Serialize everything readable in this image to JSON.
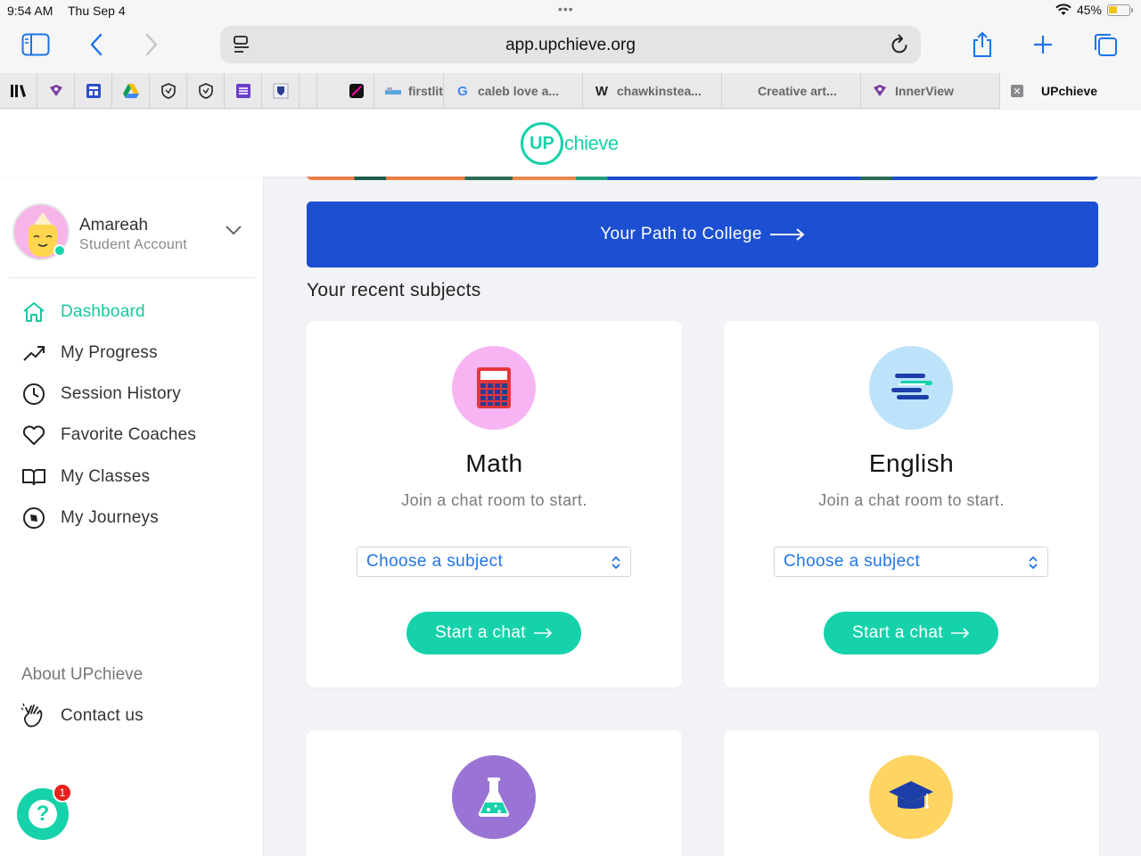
{
  "status": {
    "time": "9:54 AM",
    "date": "Thu Sep 4",
    "battery": "45%",
    "battery_level": 0.45
  },
  "browser": {
    "url": "app.upchieve.org",
    "tabs": [
      {
        "title": "firstlit",
        "icon": "book-favicon"
      },
      {
        "title": "caleb love a...",
        "icon": "google-favicon"
      },
      {
        "title": "chawkinstea...",
        "icon": "w-favicon"
      },
      {
        "title": "Creative art...",
        "icon": "blank-favicon"
      },
      {
        "title": "InnerView",
        "icon": "innerview-favicon"
      },
      {
        "title": "UPchieve",
        "icon": "close-tab-icon",
        "active": true
      }
    ]
  },
  "brand": {
    "logo_mark": "UP",
    "logo_text": "chieve",
    "accent": "#16d2aa",
    "primary": "#1c4fd1"
  },
  "user": {
    "name": "Amareah",
    "role": "Student Account"
  },
  "nav": {
    "items": [
      {
        "label": "Dashboard",
        "icon": "home-icon",
        "active": true
      },
      {
        "label": "My Progress",
        "icon": "trend-up-icon"
      },
      {
        "label": "Session History",
        "icon": "clock-icon"
      },
      {
        "label": "Favorite Coaches",
        "icon": "heart-icon"
      },
      {
        "label": "My Classes",
        "icon": "open-book-icon"
      },
      {
        "label": "My Journeys",
        "icon": "compass-icon"
      }
    ],
    "about": "About UPchieve",
    "contact": "Contact us"
  },
  "help": {
    "label": "?",
    "badge": "1"
  },
  "main": {
    "path_button": "Your Path to College",
    "recent_heading": "Your recent subjects",
    "cards": [
      {
        "title": "Math",
        "subtitle": "Join a chat room to start.",
        "select_placeholder": "Choose a subject",
        "button": "Start a chat",
        "icon": "calculator-icon"
      },
      {
        "title": "English",
        "subtitle": "Join a chat room to start.",
        "select_placeholder": "Choose a subject",
        "button": "Start a chat",
        "icon": "books-icon"
      },
      {
        "icon": "flask-icon"
      },
      {
        "icon": "graduation-cap-icon"
      }
    ]
  }
}
